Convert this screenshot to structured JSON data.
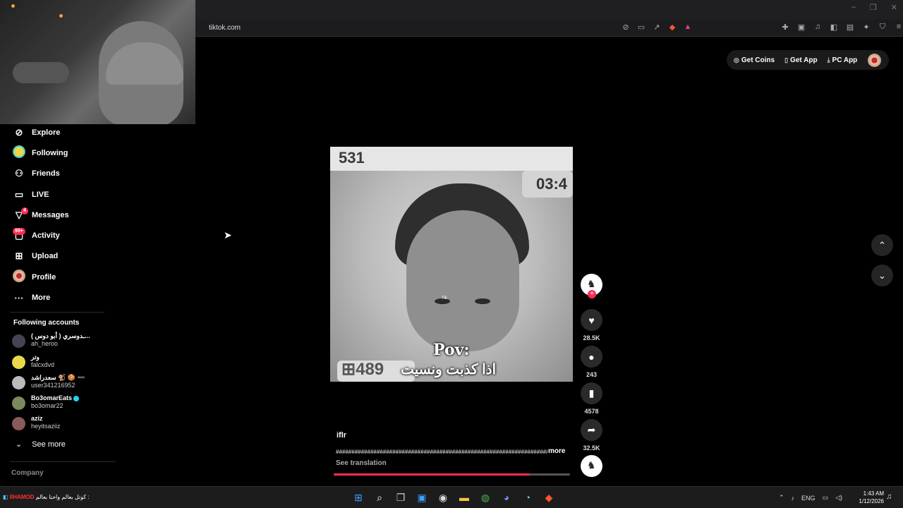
{
  "browser": {
    "url": "tiktok.com",
    "window_controls": [
      "–",
      "❐",
      "✕"
    ]
  },
  "header": {
    "get_coins": "Get Coins",
    "get_app": "Get App",
    "pc_app": "PC App"
  },
  "sidebar": {
    "items": [
      {
        "label": "Explore",
        "icon": "compass-icon"
      },
      {
        "label": "Following",
        "icon": "following-avatar-icon"
      },
      {
        "label": "Friends",
        "icon": "friends-icon"
      },
      {
        "label": "LIVE",
        "icon": "live-icon"
      },
      {
        "label": "Messages",
        "icon": "messages-icon",
        "badge": "4"
      },
      {
        "label": "Activity",
        "icon": "activity-icon",
        "badge": "99+"
      },
      {
        "label": "Upload",
        "icon": "upload-icon"
      },
      {
        "label": "Profile",
        "icon": "profile-avatar-icon"
      },
      {
        "label": "More",
        "icon": "more-icon"
      }
    ],
    "following_title": "Following accounts",
    "accounts": [
      {
        "display": "ـدوسري ( أبو دوس )...",
        "handle": "ah_heroo"
      },
      {
        "display": "وتر",
        "handle": "falcxdvd"
      },
      {
        "display": "سعدراشد 🐒 🍪 ➖",
        "handle": "user341216952"
      },
      {
        "display": "Bo3omarEats",
        "handle": "bo3omar22",
        "verified": true
      },
      {
        "display": "aziz",
        "handle": "heyitsaziiz"
      }
    ],
    "see_more": "See more",
    "company": "Company"
  },
  "video": {
    "overlay_top_number": "531",
    "overlay_timer": "03:4",
    "overlay_bottom_number": "489",
    "pov_text": "Pov:",
    "arabic_text": "اذا كذبت ونسيت",
    "watermark": "Tik",
    "username": "iflr",
    "caption": "######################################################################ه",
    "more_label": "more",
    "see_translation": "See translation",
    "progress": 0.83
  },
  "actions": {
    "likes": "28.5K",
    "comments": "243",
    "saves": "4578",
    "shares": "32.5K"
  },
  "taskbar": {
    "ticker_name": "IIHAMOD",
    "ticker_text": "كوتل بعالم واحنا بعالم :",
    "lang": "ENG",
    "time": "1:43 AM",
    "date": "1/12/2026"
  },
  "colors": {
    "accent": "#fe2c55",
    "background": "#000000",
    "sidebar_text": "#ffffff"
  }
}
